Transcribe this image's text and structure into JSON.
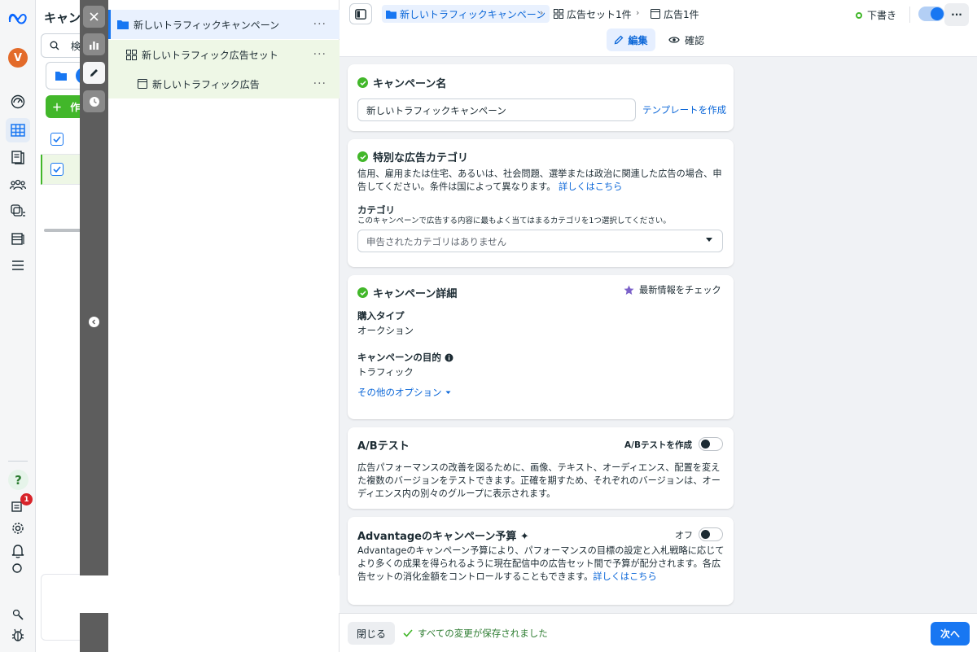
{
  "manager": {
    "title": "キャン",
    "search_placeholder": "検",
    "create_label": "作"
  },
  "rail": {
    "notification_count": "1",
    "help_label": "?",
    "avatar_initial": "V"
  },
  "tree": {
    "campaign": "新しいトラフィックキャンペーン",
    "adset": "新しいトラフィック広告セット",
    "ad": "新しいトラフィック広告",
    "more": "···"
  },
  "header": {
    "breadcrumb_campaign": "新しいトラフィックキャンペーン",
    "breadcrumb_adset": "広告セット1件",
    "breadcrumb_ad": "広告1件",
    "status": "下書き",
    "more": "···",
    "tab_edit": "編集",
    "tab_review": "確認"
  },
  "campaign_name": {
    "heading": "キャンペーン名",
    "value": "新しいトラフィックキャンペーン",
    "template_link": "テンプレートを作成"
  },
  "special_category": {
    "heading": "特別な広告カテゴリ",
    "description": "信用、雇用または住宅、あるいは、社会問題、選挙または政治に関連した広告の場合、申告してください。条件は国によって異なります。",
    "learn_more": "詳しくはこちら",
    "category_label": "カテゴリ",
    "category_hint": "このキャンペーンで広告する内容に最もよく当てはまるカテゴリを1つ選択してください。",
    "category_placeholder": "申告されたカテゴリはありません"
  },
  "campaign_details": {
    "heading": "キャンペーン詳細",
    "whats_new": "最新情報をチェック",
    "buying_type_label": "購入タイプ",
    "buying_type_value": "オークション",
    "objective_label": "キャンペーンの目的",
    "objective_value": "トラフィック",
    "more_options": "その他のオプション"
  },
  "ab_test": {
    "heading": "A/Bテスト",
    "toggle_label": "A/Bテストを作成",
    "description": "広告パフォーマンスの改善を図るために、画像、テキスト、オーディエンス、配置を変えた複数のバージョンをテストできます。正確を期すため、それぞれのバージョンは、オーディエンス内の別々のグループに表示されます。"
  },
  "advantage_budget": {
    "heading": "Advantageのキャンペーン予算 ✦",
    "toggle_label": "オフ",
    "description": "Advantageのキャンペーン予算により、パフォーマンスの目標の設定と入札戦略に応じてより多くの成果を得られるように現在配信中の広告セット間で予算が配分されます。各広告セットの消化金額をコントロールすることもできます。",
    "learn_more": "詳しくはこちら"
  },
  "footer": {
    "close": "閉じる",
    "saved": "すべての変更が保存されました",
    "next": "次へ"
  },
  "colors": {
    "accent": "#1877f2",
    "success": "#42b72a",
    "link": "#0a66d8"
  }
}
